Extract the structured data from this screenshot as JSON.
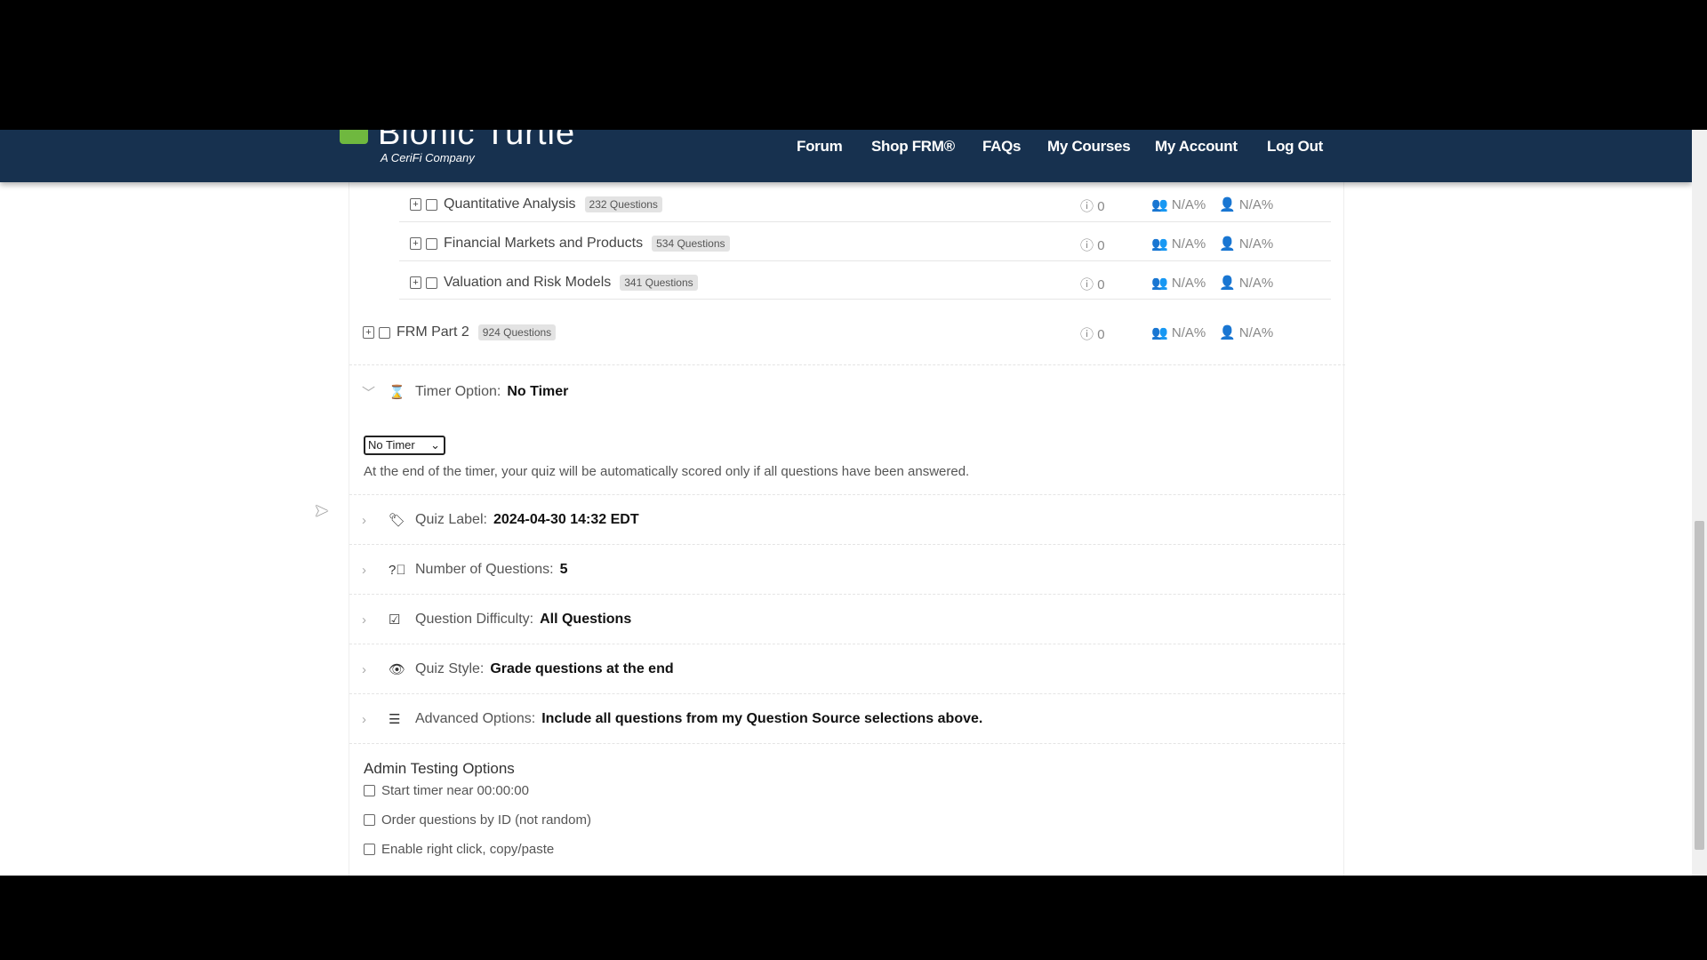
{
  "header": {
    "logo": "Bionic Turtle",
    "logo_sub": "A CeriFi Company",
    "nav": [
      "Forum",
      "Shop FRM®",
      "FAQs",
      "My Courses",
      "My Account",
      "Log Out"
    ]
  },
  "sources": [
    {
      "name": "Quantitative Analysis",
      "badge": "232 Questions",
      "count": "0",
      "group": "N/A%",
      "personal": "N/A%"
    },
    {
      "name": "Financial Markets and Products",
      "badge": "534 Questions",
      "count": "0",
      "group": "N/A%",
      "personal": "N/A%"
    },
    {
      "name": "Valuation and Risk Models",
      "badge": "341 Questions",
      "count": "0",
      "group": "N/A%",
      "personal": "N/A%"
    },
    {
      "name": "FRM Part 2",
      "badge": "924 Questions",
      "count": "0",
      "group": "N/A%",
      "personal": "N/A%"
    }
  ],
  "timer": {
    "label": "Timer Option:",
    "value": "No Timer",
    "select": "No Timer",
    "note": "At the end of the timer, your quiz will be automatically scored only if all questions have been answered."
  },
  "options": [
    {
      "icon": "tag-icon",
      "label": "Quiz Label:",
      "value": "2024-04-30 14:32 EDT"
    },
    {
      "icon": "question-circle-icon",
      "label": "Number of Questions:",
      "value": "5"
    },
    {
      "icon": "checkbox-icon",
      "label": "Question Difficulty:",
      "value": "All Questions"
    },
    {
      "icon": "eye-icon",
      "label": "Quiz Style:",
      "value": "Grade questions at the end"
    },
    {
      "icon": "sliders-icon",
      "label": "Advanced Options:",
      "value": "Include all questions from my Question Source selections above."
    }
  ],
  "admin": {
    "title": "Admin Testing Options",
    "items": [
      "Start timer near 00:00:00",
      "Order questions by ID (not random)",
      "Enable right click, copy/paste"
    ]
  }
}
